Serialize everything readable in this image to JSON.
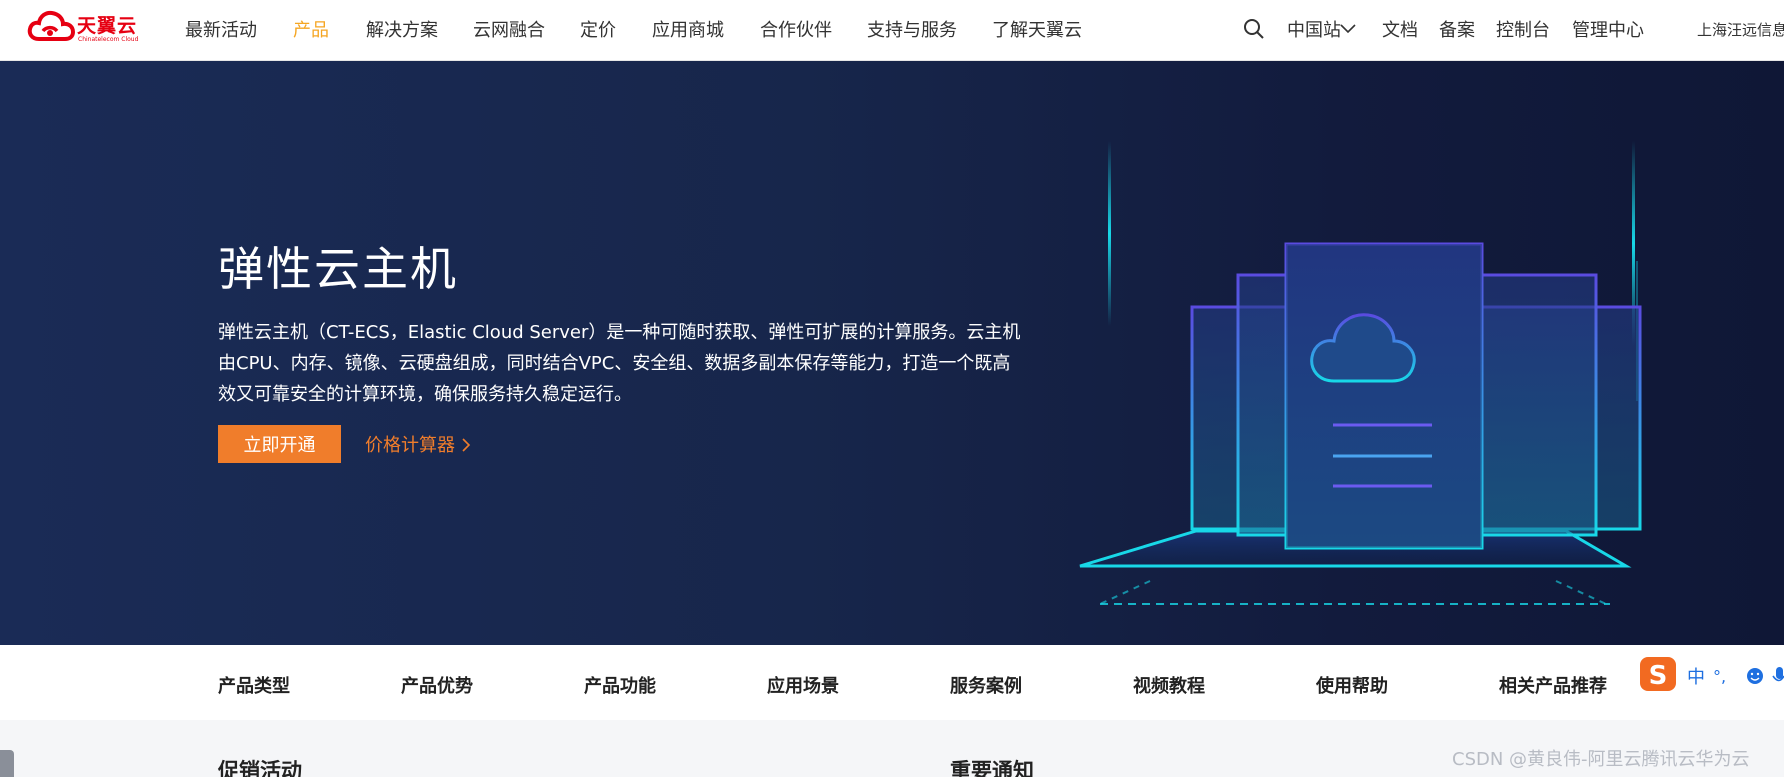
{
  "brand": {
    "name": "天翼云",
    "subtitle": "Chinatelecom Cloud",
    "color": "#e60012"
  },
  "nav": {
    "items": [
      {
        "label": "最新活动"
      },
      {
        "label": "产品",
        "active": true
      },
      {
        "label": "解决方案"
      },
      {
        "label": "云网融合"
      },
      {
        "label": "定价"
      },
      {
        "label": "应用商城"
      },
      {
        "label": "合作伙伴"
      },
      {
        "label": "支持与服务"
      },
      {
        "label": "了解天翼云"
      }
    ],
    "search_icon": "search-icon",
    "station": "中国站",
    "right_links": [
      "文档",
      "备案",
      "控制台",
      "管理中心"
    ],
    "user": "上海汪远信息"
  },
  "hero": {
    "title": "弹性云主机",
    "description": "弹性云主机（CT-ECS，Elastic Cloud Server）是一种可随时获取、弹性可扩展的计算服务。云主机由CPU、内存、镜像、云硬盘组成，同时结合VPC、安全组、数据多副本保存等能力，打造一个既高效又可靠安全的计算环境，确保服务持久稳定运行。",
    "primary_button": "立即开通",
    "secondary_link": "价格计算器",
    "accent_color": "#f07d2b",
    "background": "#17264b"
  },
  "subtabs": [
    "产品类型",
    "产品优势",
    "产品功能",
    "应用场景",
    "服务案例",
    "视频教程",
    "使用帮助",
    "相关产品推荐"
  ],
  "sections": {
    "promotions": "促销活动",
    "notices": "重要通知"
  },
  "ime": {
    "mode": "中",
    "punct": "°,",
    "icons": [
      "sogou-logo-icon",
      "emoji-icon",
      "microphone-icon"
    ]
  },
  "watermark": "CSDN @黄良伟-阿里云腾讯云华为云"
}
